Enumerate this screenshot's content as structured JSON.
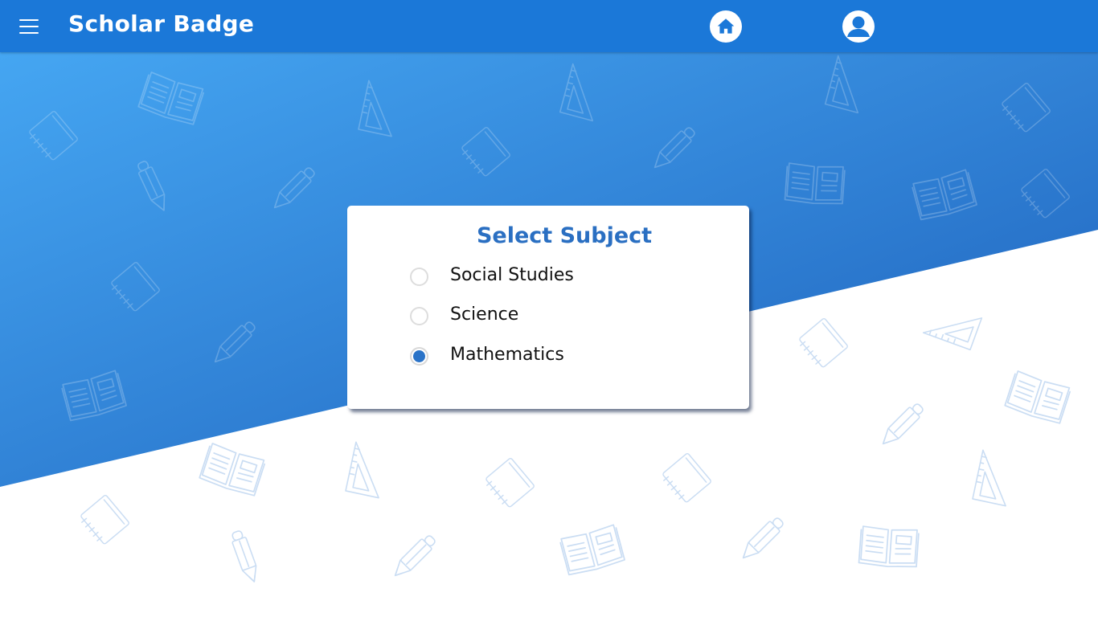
{
  "header": {
    "title": "Scholar Badge",
    "menu_icon": "hamburger-menu-icon",
    "home_icon": "home-icon",
    "profile_icon": "user-account-icon"
  },
  "subject_card": {
    "title": "Select Subject",
    "options": [
      {
        "label": "Social Studies",
        "selected": false
      },
      {
        "label": "Science",
        "selected": false
      },
      {
        "label": "Mathematics",
        "selected": true
      }
    ]
  },
  "colors": {
    "header": "#1b78d8",
    "gradient_start": "#42a2f0",
    "gradient_end": "#1f62bd",
    "title": "#2a6fc2",
    "radio_selected": "#2a73c8",
    "doodle": "#c9dcf3"
  },
  "background": {
    "doodle_icons": [
      "notebook-icon",
      "open-book-icon",
      "triangle-ruler-icon",
      "pencil-icon"
    ]
  }
}
